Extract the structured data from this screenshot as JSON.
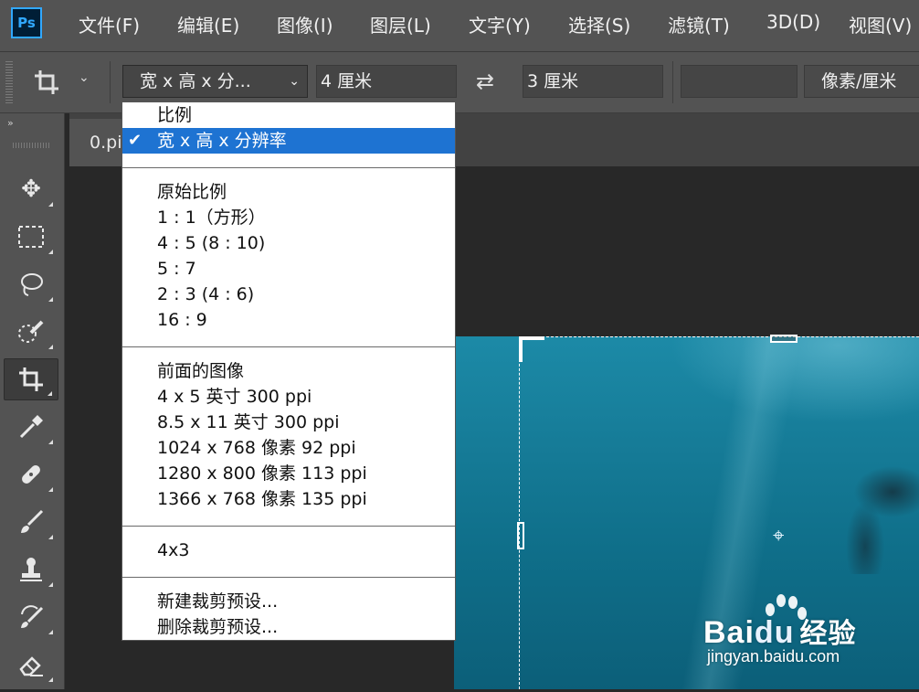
{
  "menubar": {
    "logo": "Ps",
    "items": [
      "文件(F)",
      "编辑(E)",
      "图像(I)",
      "图层(L)",
      "文字(Y)",
      "选择(S)",
      "滤镜(T)",
      "3D(D)",
      "视图(V)"
    ]
  },
  "options": {
    "ratio_select": "宽 x 高 x 分...",
    "width_value": "4 厘米",
    "height_value": "3 厘米",
    "resolution_value": "",
    "unit_label": "像素/厘米"
  },
  "document": {
    "tab_label": "0.pi"
  },
  "dropdown": {
    "items": [
      {
        "label": "比例",
        "selected": false
      },
      {
        "label": "宽 x 高 x 分辨率",
        "selected": true
      },
      {
        "label": "原始比例"
      },
      {
        "label": "1 : 1（方形）"
      },
      {
        "label": "4 : 5 (8 : 10)"
      },
      {
        "label": "5 : 7"
      },
      {
        "label": "2 : 3 (4 : 6)"
      },
      {
        "label": "16 : 9"
      },
      {
        "label": "前面的图像"
      },
      {
        "label": "4 x 5 英寸 300 ppi"
      },
      {
        "label": "8.5 x 11 英寸 300 ppi"
      },
      {
        "label": "1024 x 768 像素 92 ppi"
      },
      {
        "label": "1280 x 800 像素 113 ppi"
      },
      {
        "label": "1366 x 768 像素 135 ppi"
      },
      {
        "label": "4x3"
      },
      {
        "label": "新建裁剪预设..."
      },
      {
        "label": "删除裁剪预设..."
      }
    ]
  },
  "watermark": {
    "brand_bai": "Bai",
    "brand_du": "du",
    "brand_jingyan": "经验",
    "url": "jingyan.baidu.com"
  },
  "colors": {
    "accent_blue": "#1e73d2",
    "ps_blue": "#31a8ff",
    "panel_gray": "#535353"
  }
}
